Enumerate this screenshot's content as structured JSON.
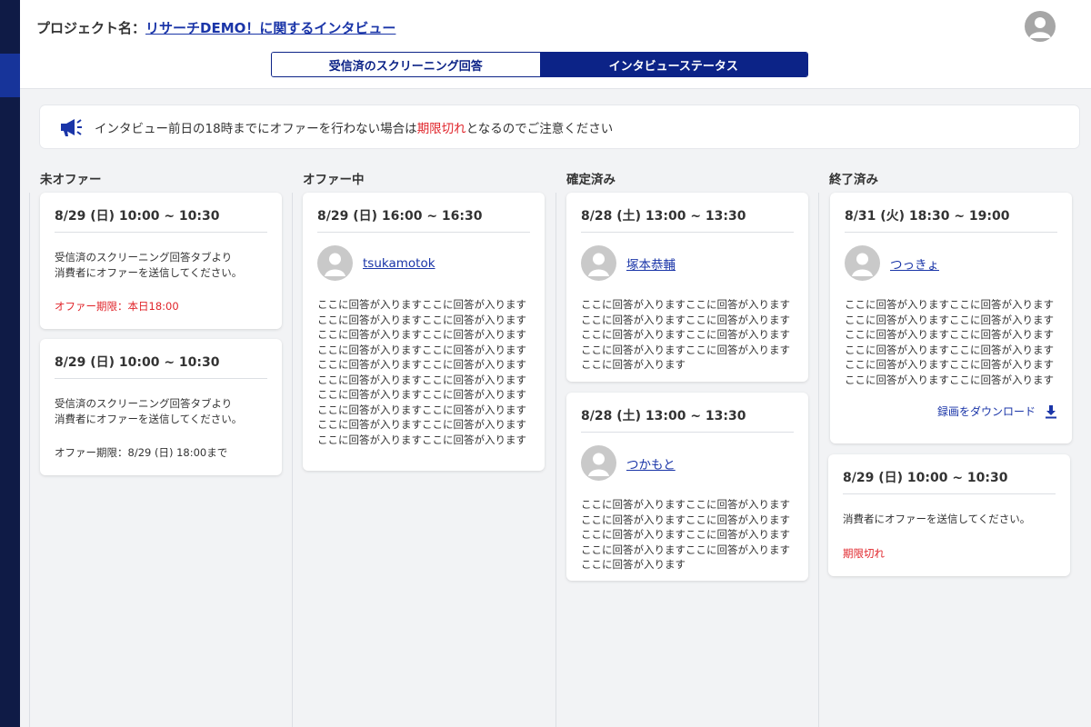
{
  "header": {
    "project_label": "プロジェクト名：",
    "project_name": "リサーチDEMO！に関するインタビュー",
    "tabs": [
      {
        "label": "受信済のスクリーニング回答",
        "active": false
      },
      {
        "label": "インタビューステータス",
        "active": true
      }
    ]
  },
  "notice": {
    "icon": "megaphone-icon",
    "text_before": "インタビュー前日の18時までにオファーを行わない場合は",
    "text_highlight": "期限切れ",
    "text_after": "となるのでご注意ください"
  },
  "columns": [
    {
      "title": "未オファー",
      "cards": [
        {
          "date": "8/29 (日) 10:00 ~ 10:30",
          "text": "受信済のスクリーニング回答タブより\n消費者にオファーを送信してください。",
          "deadline": "オファー期限：本日18:00"
        },
        {
          "date": "8/29 (日) 10:00 ~ 10:30",
          "text": "受信済のスクリーニング回答タブより\n消費者にオファーを送信してください。",
          "deadline": "オファー期限：8/29 (日) 18:00まで"
        }
      ]
    },
    {
      "title": "オファー中",
      "cards": [
        {
          "date": "8/29 (日) 16:00 ~ 16:30",
          "user": "tsukamotok",
          "answer": "ここに回答が入りますここに回答が入りますここに回答が入りますここに回答が入りますここに回答が入りますここに回答が入りますここに回答が入りますここに回答が入りますここに回答が入りますここに回答が入りますここに回答が入りますここに回答が入りますここに回答が入りますここに回答が入りますここに回答が入りますここに回答が入りますここに回答が入りますここに回答が入りますここに回答が入りますここに回答が入ります"
        }
      ]
    },
    {
      "title": "確定済み",
      "cards": [
        {
          "date": "8/28 (土) 13:00 ~ 13:30",
          "user": "塚本恭輔",
          "answer": "ここに回答が入りますここに回答が入りますここに回答が入りますここに回答が入りますここに回答が入りますここに回答が入りますここに回答が入りますここに回答が入りますここに回答が入ります"
        },
        {
          "date": "8/28 (土) 13:00 ~ 13:30",
          "user": "つかもと",
          "answer": "ここに回答が入りますここに回答が入りますここに回答が入りますここに回答が入りますここに回答が入りますここに回答が入りますここに回答が入りますここに回答が入りますここに回答が入ります"
        }
      ]
    },
    {
      "title": "終了済み",
      "cards": [
        {
          "date": "8/31 (火) 18:30 ~ 19:00",
          "user": "つっきょ",
          "answer": "ここに回答が入りますここに回答が入りますここに回答が入りますここに回答が入りますここに回答が入りますここに回答が入りますここに回答が入りますここに回答が入りますここに回答が入りますここに回答が入りますここに回答が入りますここに回答が入ります",
          "download": "録画をダウンロード"
        },
        {
          "date": "8/29 (日) 10:00 ~ 10:30",
          "text": "消費者にオファーを送信してください。",
          "deadline": "期限切れ"
        }
      ]
    }
  ],
  "colors": {
    "navy": "#0c2387",
    "link": "#1a35a8",
    "alert_red": "#e0242a",
    "sidebar": "#0f1b46"
  }
}
